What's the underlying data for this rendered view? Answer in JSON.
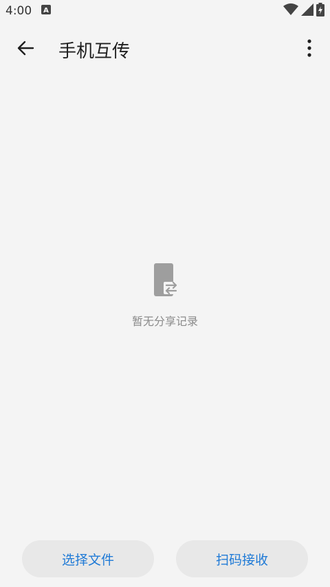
{
  "status": {
    "time": "4:00",
    "notification_icon": "a-icon",
    "wifi_icon": "wifi-icon",
    "signal_icon": "signal-icon",
    "battery_icon": "battery-charging-icon"
  },
  "appbar": {
    "title": "手机互传",
    "back_icon": "arrow-left-icon",
    "more_icon": "more-vertical-icon"
  },
  "empty_state": {
    "icon": "phone-transfer-icon",
    "text": "暂无分享记录"
  },
  "actions": {
    "select_files": "选择文件",
    "scan_receive": "扫码接收"
  },
  "colors": {
    "accent": "#1f7ad6",
    "background": "#f4f4f4",
    "button_bg": "#e8e8e8"
  }
}
